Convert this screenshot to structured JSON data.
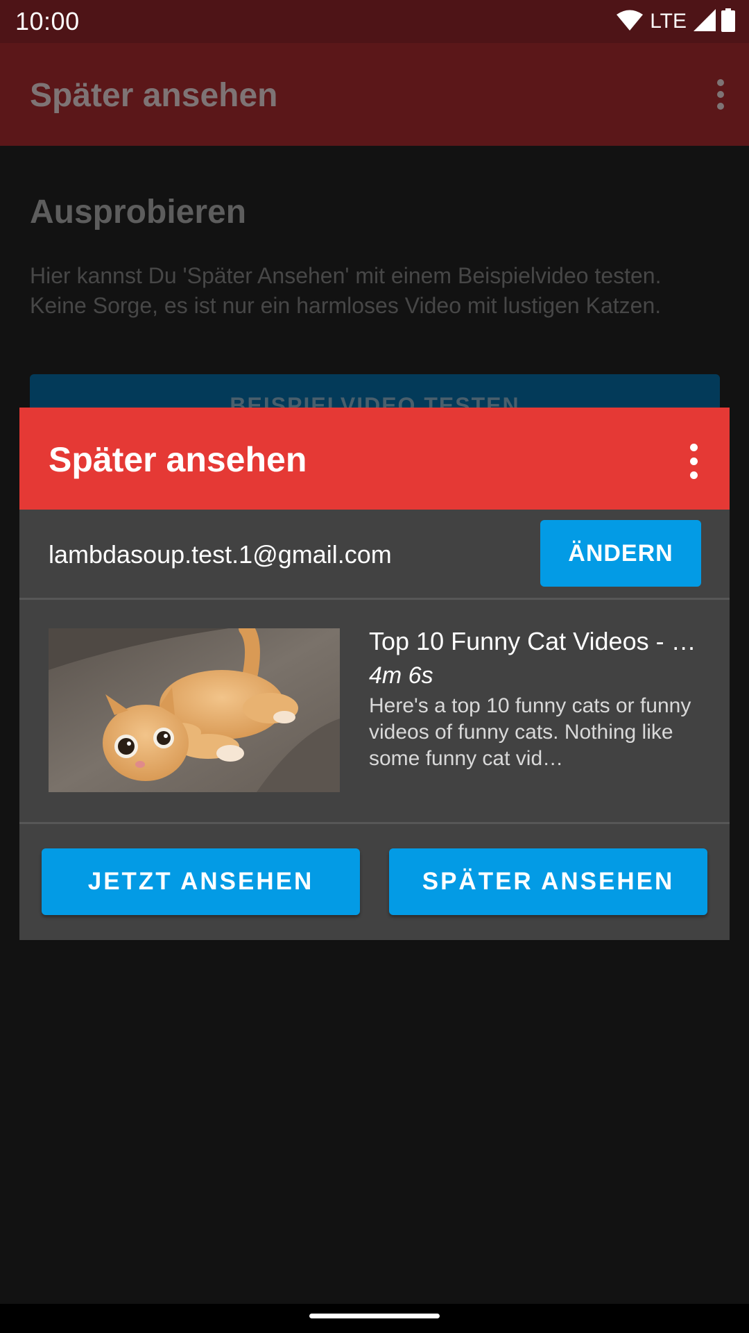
{
  "status_bar": {
    "time": "10:00",
    "network": "LTE",
    "icons": [
      "wifi-icon",
      "signal-icon",
      "battery-icon"
    ]
  },
  "app_bar": {
    "title": "Später ansehen",
    "menu_icon": "more-vert-icon"
  },
  "background": {
    "heading": "Ausprobieren",
    "text": "Hier kannst Du 'Später Ansehen' mit einem Beispielvideo testen. Keine Sorge, es ist nur ein harmloses Video mit lustigen Katzen.",
    "button_label": "BEISPIELVIDEO TESTEN"
  },
  "dialog": {
    "title": "Später ansehen",
    "menu_icon": "more-vert-icon",
    "account": {
      "email": "lambdasoup.test.1@gmail.com",
      "change_label": "ÄNDERN"
    },
    "video": {
      "title": "Top 10 Funny Cat Videos - …",
      "duration": "4m 6s",
      "description": "Here's a top 10 funny cats or funny videos of funny cats. Nothing like some funny cat vid…"
    },
    "actions": {
      "watch_now_label": "JETZT ANSEHEN",
      "watch_later_label": "SPÄTER ANSEHEN"
    }
  },
  "colors": {
    "dialog_header": "#e53935",
    "accent_button": "#039be5",
    "dialog_body": "#424242",
    "app_bar_dimmed": "#5b1719"
  }
}
